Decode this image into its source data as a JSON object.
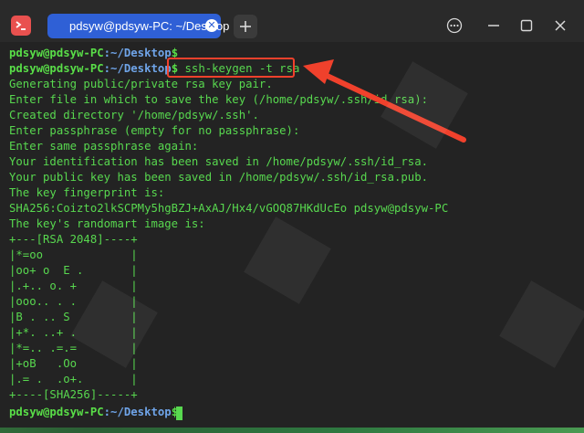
{
  "window": {
    "tab_title": "pdsyw@pdsyw-PC: ~/Desktop",
    "tab_close_glyph": "✕",
    "new_tab_glyph": "+"
  },
  "terminal": {
    "prompt_user": "pdsyw@pdsyw-PC",
    "prompt_path": ":~/Desktop",
    "prompt_symbol": "$",
    "command": " ssh-keygen -t rsa",
    "output": [
      "Generating public/private rsa key pair.",
      "Enter file in which to save the key (/home/pdsyw/.ssh/id_rsa):",
      "Created directory '/home/pdsyw/.ssh'.",
      "Enter passphrase (empty for no passphrase):",
      "Enter same passphrase again:",
      "Your identification has been saved in /home/pdsyw/.ssh/id_rsa.",
      "Your public key has been saved in /home/pdsyw/.ssh/id_rsa.pub.",
      "The key fingerprint is:",
      "SHA256:Coizto2lkSCPMy5hgBZJ+AxAJ/Hx4/vGOQ87HKdUcEo pdsyw@pdsyw-PC",
      "The key's randomart image is:",
      "+---[RSA 2048]----+",
      "|*=oo             |",
      "|oo+ o  E .       |",
      "|.+.. o. +        |",
      "|ooo.. . .        |",
      "|B . .. S         |",
      "|+*. ..+ .        |",
      "|*=.. .=.=        |",
      "|+oB   .Oo        |",
      "|.= .  .o+.       |",
      "+----[SHA256]-----+"
    ]
  },
  "colors": {
    "accent_tab": "#2f60d6",
    "prompt_green": "#59de48",
    "path_blue": "#6fa4e8",
    "output_green": "#58d84f",
    "highlight_red": "#f0412c"
  }
}
